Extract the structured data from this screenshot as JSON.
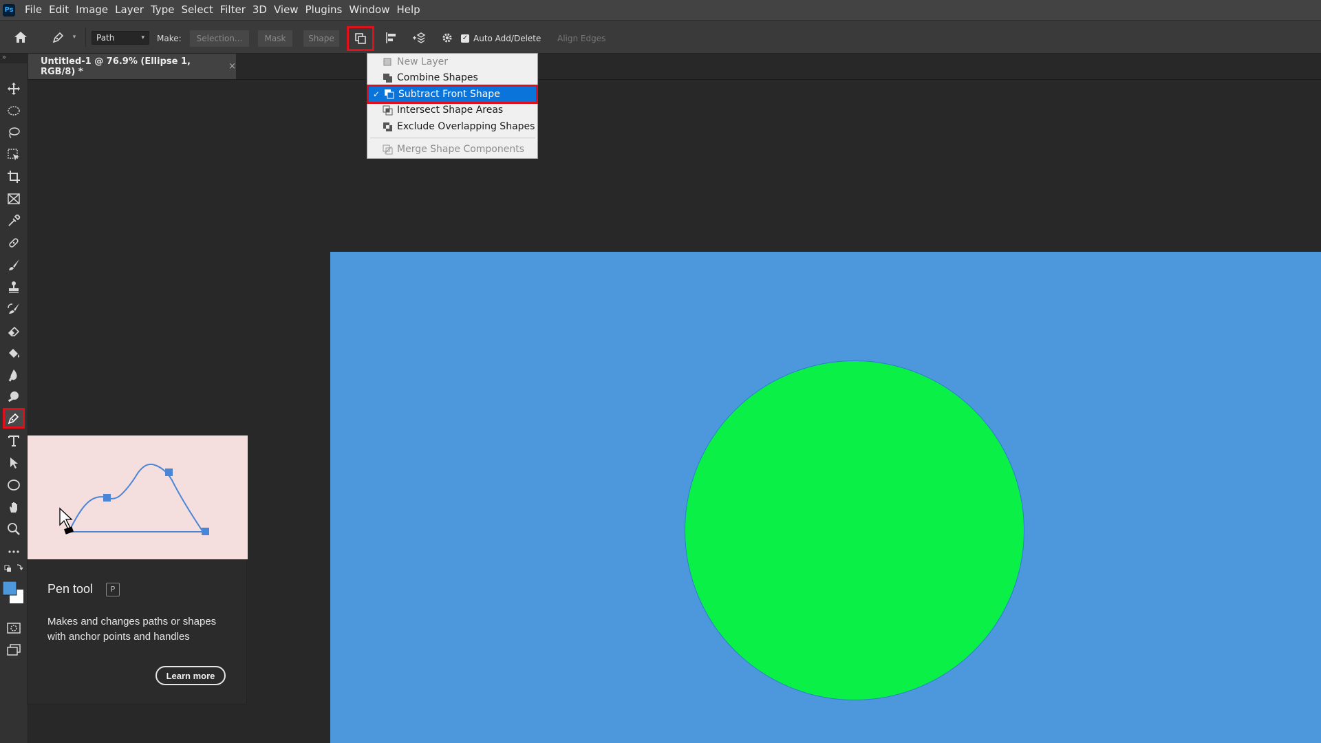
{
  "app": {
    "logo": "Ps"
  },
  "menubar": {
    "items": [
      "File",
      "Edit",
      "Image",
      "Layer",
      "Type",
      "Select",
      "Filter",
      "3D",
      "View",
      "Plugins",
      "Window",
      "Help"
    ]
  },
  "options_bar": {
    "mode_value": "Path",
    "make_label": "Make:",
    "selection_label": "Selection...",
    "mask_label": "Mask",
    "shape_label": "Shape",
    "auto_add_delete_label": "Auto Add/Delete",
    "auto_add_delete_checked": true,
    "align_edges_label": "Align Edges"
  },
  "document": {
    "tab_title": "Untitled-1 @ 76.9% (Ellipse 1, RGB/8) *",
    "close_glyph": "×",
    "canvas_color": "#4d98dc",
    "ellipse_color": "#0af046"
  },
  "path_operations_menu": {
    "items": [
      {
        "label": "New Layer",
        "enabled": false,
        "checked": false,
        "icon": "new-layer-icon"
      },
      {
        "label": "Combine Shapes",
        "enabled": true,
        "checked": false,
        "icon": "combine-shapes-icon"
      },
      {
        "label": "Subtract Front Shape",
        "enabled": true,
        "checked": true,
        "icon": "subtract-front-shape-icon"
      },
      {
        "label": "Intersect Shape Areas",
        "enabled": true,
        "checked": false,
        "icon": "intersect-shape-areas-icon"
      },
      {
        "label": "Exclude Overlapping Shapes",
        "enabled": true,
        "checked": false,
        "icon": "exclude-overlapping-shapes-icon"
      },
      {
        "label": "Merge Shape Components",
        "enabled": false,
        "checked": false,
        "icon": "merge-shape-components-icon"
      }
    ],
    "check_glyph": "✓"
  },
  "tooltip": {
    "title": "Pen tool",
    "shortcut": "P",
    "description": "Makes and changes paths or shapes with anchor points and handles",
    "learn_more": "Learn more"
  },
  "colors": {
    "highlight_red": "#e0101a",
    "menu_selection": "#0a74da",
    "foreground_swatch": "#4d98dc",
    "background_swatch": "#ffffff"
  }
}
